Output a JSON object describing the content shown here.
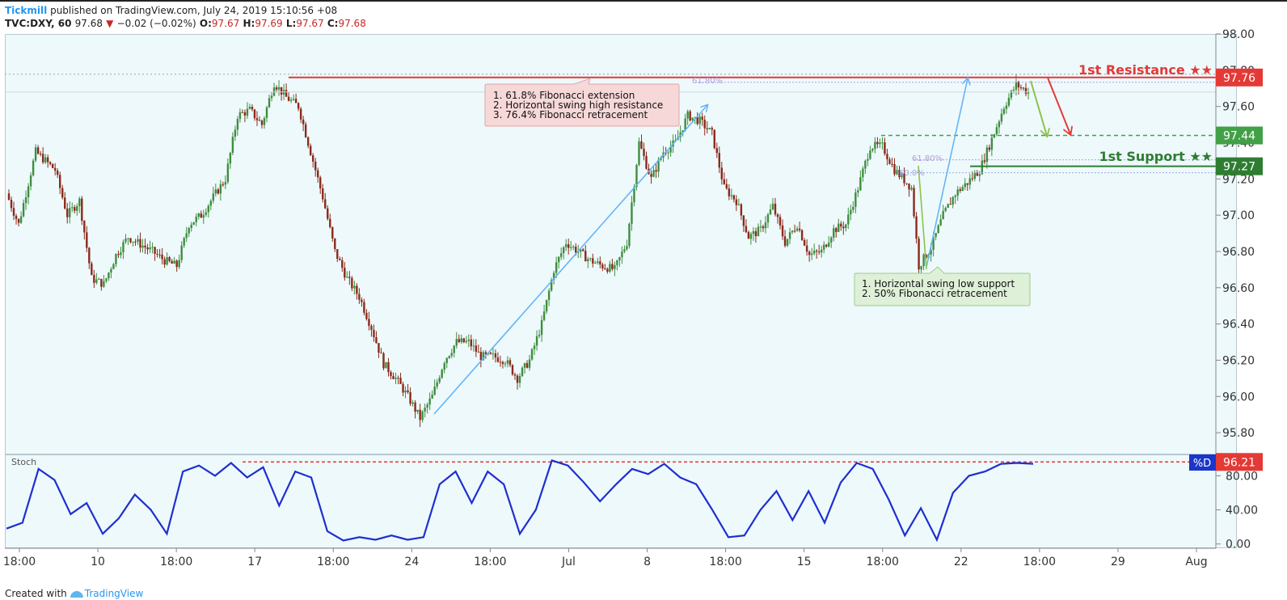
{
  "header": {
    "author": "Tickmill",
    "published": "published on TradingView.com, July 24, 2019 15:10:56 +08",
    "symbol": "TVC:DXY, 60",
    "last": "97.68",
    "change_arrow": "▼",
    "change": "−0.02 (−0.02%)",
    "o_label": "O:",
    "o": "97.67",
    "h_label": "H:",
    "h": "97.69",
    "l_label": "L:",
    "l": "97.67",
    "c_label": "C:",
    "c": "97.68"
  },
  "annotations": {
    "resistance_label": "1st Resistance ★★",
    "support_label": "1st Support ★★",
    "resistance_box": [
      "1. 61.8% Fibonacci extension",
      "2. Horizontal swing high resistance",
      "3. 76.4% Fibonacci retracement"
    ],
    "support_box": [
      "1. Horizontal swing low support",
      "2. 50% Fibonacci retracement"
    ],
    "fib_618_top": "61.80%",
    "fib_618_mid": "61.80%",
    "fib_50": "50.0%",
    "stoch_label": "Stoch",
    "stoch_d_label": "%D"
  },
  "colors": {
    "resistance": "#e53935",
    "support": "#2e7d32",
    "support_dashed": "#43a047",
    "arrow_blue": "#64b5f6",
    "stoch_line": "#1e2fd0",
    "candle_up": "#3e8e3e",
    "candle_down": "#8a2a1a"
  },
  "chart_data": [
    {
      "type": "candlestick",
      "title": "TVC:DXY, 60",
      "x_tick_labels": [
        "18:00",
        "10",
        "18:00",
        "17",
        "18:00",
        "24",
        "18:00",
        "Jul",
        "8",
        "18:00",
        "15",
        "18:00",
        "22",
        "18:00",
        "29",
        "Aug"
      ],
      "y_ticks": [
        95.8,
        96.0,
        96.2,
        96.4,
        96.6,
        96.8,
        97.0,
        97.2,
        97.4,
        97.6,
        97.8,
        98.0
      ],
      "ylim": [
        95.68,
        98.0
      ],
      "levels": [
        {
          "name": "1st Resistance",
          "value": 97.76
        },
        {
          "name": "dashed support",
          "value": 97.44
        },
        {
          "name": "1st Support",
          "value": 97.27
        }
      ],
      "price_path": [
        {
          "x": 0,
          "y": 97.12
        },
        {
          "x": 0.5,
          "y": 96.95
        },
        {
          "x": 1.2,
          "y": 97.35
        },
        {
          "x": 2.0,
          "y": 97.25
        },
        {
          "x": 2.5,
          "y": 97.0
        },
        {
          "x": 3.0,
          "y": 97.08
        },
        {
          "x": 3.5,
          "y": 96.65
        },
        {
          "x": 4.0,
          "y": 96.62
        },
        {
          "x": 4.5,
          "y": 96.78
        },
        {
          "x": 5.0,
          "y": 96.88
        },
        {
          "x": 6.0,
          "y": 96.8
        },
        {
          "x": 6.5,
          "y": 96.75
        },
        {
          "x": 7.0,
          "y": 96.72
        },
        {
          "x": 7.5,
          "y": 96.95
        },
        {
          "x": 8.0,
          "y": 97.0
        },
        {
          "x": 8.5,
          "y": 97.1
        },
        {
          "x": 9.0,
          "y": 97.2
        },
        {
          "x": 9.5,
          "y": 97.55
        },
        {
          "x": 10.0,
          "y": 97.58
        },
        {
          "x": 10.5,
          "y": 97.5
        },
        {
          "x": 11.0,
          "y": 97.73
        },
        {
          "x": 11.5,
          "y": 97.65
        },
        {
          "x": 12.0,
          "y": 97.6
        },
        {
          "x": 12.5,
          "y": 97.35
        },
        {
          "x": 13.0,
          "y": 97.1
        },
        {
          "x": 13.5,
          "y": 96.8
        },
        {
          "x": 14.0,
          "y": 96.65
        },
        {
          "x": 14.5,
          "y": 96.55
        },
        {
          "x": 15.0,
          "y": 96.38
        },
        {
          "x": 15.5,
          "y": 96.18
        },
        {
          "x": 16.0,
          "y": 96.1
        },
        {
          "x": 16.5,
          "y": 96.0
        },
        {
          "x": 17.0,
          "y": 95.88
        },
        {
          "x": 17.5,
          "y": 96.0
        },
        {
          "x": 18.0,
          "y": 96.2
        },
        {
          "x": 18.5,
          "y": 96.3
        },
        {
          "x": 19.0,
          "y": 96.3
        },
        {
          "x": 19.5,
          "y": 96.22
        },
        {
          "x": 20.0,
          "y": 96.22
        },
        {
          "x": 20.5,
          "y": 96.2
        },
        {
          "x": 21.0,
          "y": 96.1
        },
        {
          "x": 21.5,
          "y": 96.2
        },
        {
          "x": 22.0,
          "y": 96.4
        },
        {
          "x": 22.5,
          "y": 96.7
        },
        {
          "x": 23.0,
          "y": 96.85
        },
        {
          "x": 23.5,
          "y": 96.8
        },
        {
          "x": 24.0,
          "y": 96.75
        },
        {
          "x": 24.5,
          "y": 96.72
        },
        {
          "x": 25.0,
          "y": 96.7
        },
        {
          "x": 25.5,
          "y": 96.85
        },
        {
          "x": 26.0,
          "y": 97.4
        },
        {
          "x": 26.5,
          "y": 97.2
        },
        {
          "x": 27.0,
          "y": 97.35
        },
        {
          "x": 27.5,
          "y": 97.4
        },
        {
          "x": 28.0,
          "y": 97.55
        },
        {
          "x": 28.5,
          "y": 97.52
        },
        {
          "x": 29.0,
          "y": 97.45
        },
        {
          "x": 29.5,
          "y": 97.15
        },
        {
          "x": 30.0,
          "y": 97.08
        },
        {
          "x": 30.5,
          "y": 96.88
        },
        {
          "x": 31.0,
          "y": 96.92
        },
        {
          "x": 31.5,
          "y": 97.05
        },
        {
          "x": 32.0,
          "y": 96.85
        },
        {
          "x": 32.5,
          "y": 96.95
        },
        {
          "x": 33.0,
          "y": 96.78
        },
        {
          "x": 33.5,
          "y": 96.8
        },
        {
          "x": 34.0,
          "y": 96.92
        },
        {
          "x": 34.5,
          "y": 96.95
        },
        {
          "x": 35.0,
          "y": 97.15
        },
        {
          "x": 35.5,
          "y": 97.38
        },
        {
          "x": 36.0,
          "y": 97.38
        },
        {
          "x": 36.5,
          "y": 97.25
        },
        {
          "x": 37.0,
          "y": 97.18
        },
        {
          "x": 37.2,
          "y": 97.15
        },
        {
          "x": 37.5,
          "y": 96.72
        },
        {
          "x": 38.0,
          "y": 96.82
        },
        {
          "x": 38.5,
          "y": 97.0
        },
        {
          "x": 39.0,
          "y": 97.12
        },
        {
          "x": 39.5,
          "y": 97.18
        },
        {
          "x": 40.0,
          "y": 97.25
        },
        {
          "x": 40.5,
          "y": 97.42
        },
        {
          "x": 41.0,
          "y": 97.6
        },
        {
          "x": 41.5,
          "y": 97.72
        },
        {
          "x": 42.0,
          "y": 97.68
        }
      ]
    },
    {
      "type": "line",
      "title": "Stoch",
      "y_ticks": [
        0.0,
        40.0,
        80.0
      ],
      "ylim": [
        -5,
        105
      ],
      "levels": [
        {
          "name": "%D",
          "value": 96.21
        }
      ],
      "series": [
        {
          "name": "%D",
          "values": [
            18,
            25,
            88,
            75,
            35,
            48,
            12,
            30,
            58,
            40,
            12,
            85,
            92,
            80,
            95,
            78,
            90,
            45,
            85,
            78,
            15,
            4,
            8,
            5,
            10,
            5,
            8,
            70,
            85,
            48,
            85,
            70,
            12,
            40,
            98,
            92,
            72,
            50,
            70,
            88,
            82,
            94,
            78,
            70,
            40,
            8,
            10,
            40,
            62,
            28,
            62,
            25,
            72,
            95,
            88,
            52,
            10,
            42,
            5,
            60,
            80,
            85,
            94,
            95,
            94
          ]
        }
      ]
    }
  ]
}
